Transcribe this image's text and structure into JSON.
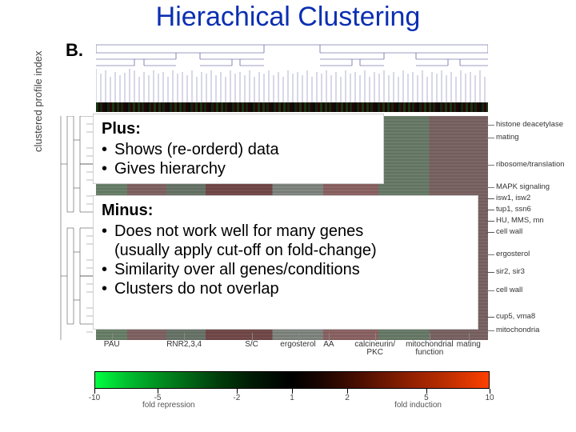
{
  "title": "Hierachical Clustering",
  "panel_label": "B.",
  "y_axis_label": "clustered profile index",
  "plus_box": {
    "heading": "Plus:",
    "items": [
      "Shows (re-orderd) data",
      "Gives hierarchy"
    ]
  },
  "minus_box": {
    "heading": "Minus:",
    "items": [
      {
        "text": "Does not work well for many genes",
        "sub": "(usually apply cut-off on fold-change)"
      },
      {
        "text": "Similarity over all genes/conditions",
        "sub": null
      },
      {
        "text": "Clusters do not overlap",
        "sub": null
      }
    ]
  },
  "right_annotations": [
    {
      "label": "histone deacetylase",
      "top_pct": 2
    },
    {
      "label": "mating",
      "top_pct": 8
    },
    {
      "label": "ribosome/translation",
      "top_pct": 20
    },
    {
      "label": "MAPK signaling",
      "top_pct": 30
    },
    {
      "label": "isw1, isw2",
      "top_pct": 35
    },
    {
      "label": "tup1, ssn6",
      "top_pct": 40
    },
    {
      "label": "HU, MMS, mn",
      "top_pct": 45
    },
    {
      "label": "cell wall",
      "top_pct": 50
    },
    {
      "label": "ergosterol",
      "top_pct": 60
    },
    {
      "label": "sir2, sir3",
      "top_pct": 68
    },
    {
      "label": "cell wall",
      "top_pct": 76
    },
    {
      "label": "cup5, vma8",
      "top_pct": 88
    },
    {
      "label": "mitochondria",
      "top_pct": 94
    }
  ],
  "bottom_categories": [
    {
      "label": "PAU",
      "left_pct": 2
    },
    {
      "label": "RNR2,3,4",
      "left_pct": 18
    },
    {
      "label": "S/C",
      "left_pct": 38
    },
    {
      "label": "ergosterol",
      "left_pct": 47
    },
    {
      "label": "AA",
      "left_pct": 58
    },
    {
      "label": "calcineurin/\nPKC",
      "left_pct": 66
    },
    {
      "label": "mitochondrial\nfunction",
      "left_pct": 79
    },
    {
      "label": "mating",
      "left_pct": 92
    }
  ],
  "color_scale": {
    "left_label": "fold repression",
    "right_label": "fold induction",
    "ticks": [
      {
        "value": "-10",
        "pos_pct": 0
      },
      {
        "value": "-5",
        "pos_pct": 16
      },
      {
        "value": "-2",
        "pos_pct": 36
      },
      {
        "value": "1",
        "pos_pct": 50
      },
      {
        "value": "2",
        "pos_pct": 64
      },
      {
        "value": "5",
        "pos_pct": 84
      },
      {
        "value": "10",
        "pos_pct": 100
      }
    ]
  },
  "chart_data": {
    "type": "heatmap",
    "title": "Hierachical Clustering",
    "ylabel": "clustered profile index",
    "xlabel": "",
    "color_scale": {
      "metric_left": "fold repression",
      "metric_right": "fold induction",
      "range": [
        -10,
        10
      ],
      "tick_values": [
        -10,
        -5,
        -2,
        1,
        2,
        5,
        10
      ],
      "gradient": [
        "green",
        "black",
        "red"
      ]
    },
    "column_cluster_categories": [
      "PAU",
      "RNR2,3,4",
      "S/C",
      "ergosterol",
      "AA",
      "calcineurin/PKC",
      "mitochondrial function",
      "mating"
    ],
    "row_cluster_categories": [
      "histone deacetylase",
      "mating",
      "ribosome/translation",
      "MAPK signaling",
      "isw1, isw2",
      "tup1, ssn6",
      "HU, MMS, mn",
      "cell wall",
      "ergosterol",
      "sir2, sir3",
      "cell wall",
      "cup5, vma8",
      "mitochondria"
    ],
    "note": "Heatmap cell values are not individually legible in the source; only axis/cluster annotations and the color scale are resolvable."
  }
}
